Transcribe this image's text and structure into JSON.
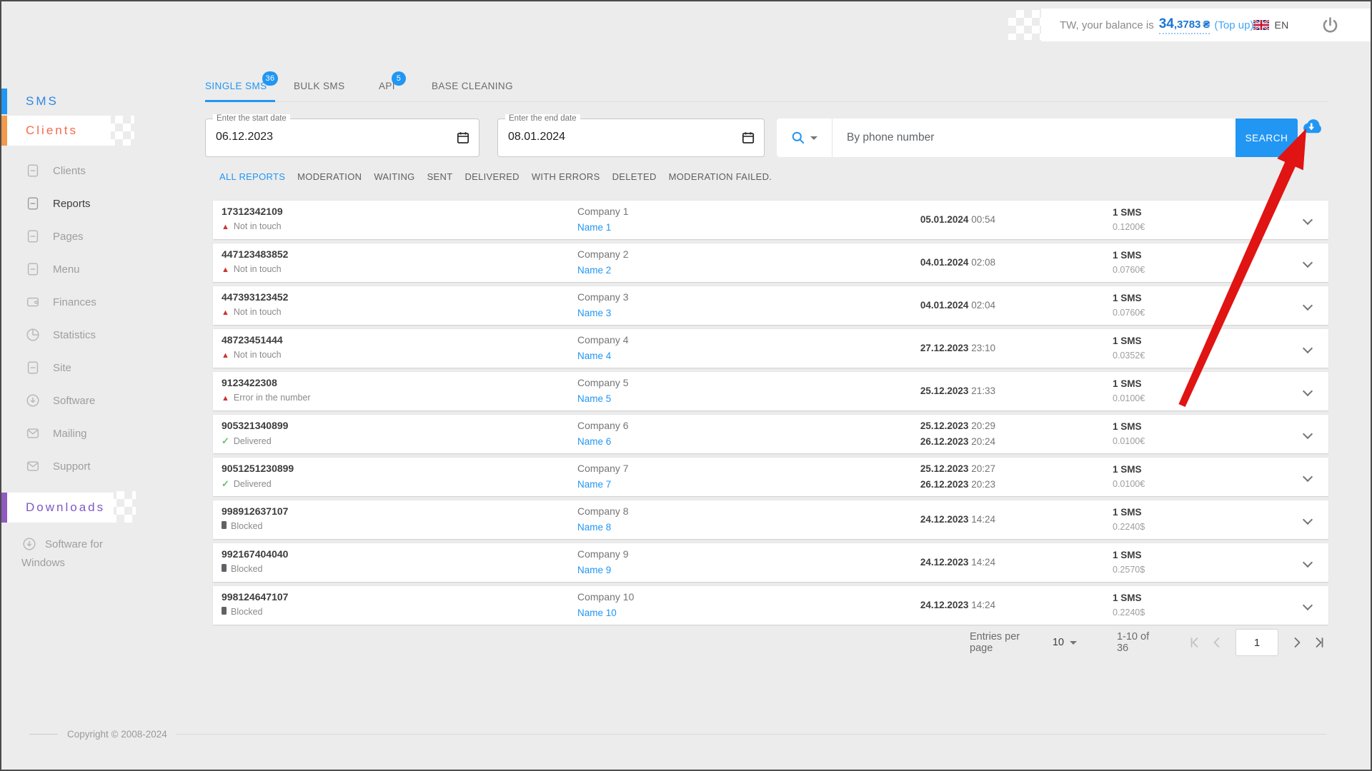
{
  "topbar": {
    "balance_prefix": "TW, your balance is",
    "balance_main": "34",
    "balance_frac": ",3783",
    "currency": "₴",
    "top_up": "(Top up)",
    "language": "EN"
  },
  "sidebar": {
    "group_sms": "SMS",
    "group_clients": "Clients",
    "nav": [
      {
        "label": "Clients",
        "icon": "document"
      },
      {
        "label": "Reports",
        "icon": "document"
      },
      {
        "label": "Pages",
        "icon": "document"
      },
      {
        "label": "Menu",
        "icon": "document"
      },
      {
        "label": "Finances",
        "icon": "wallet"
      },
      {
        "label": "Statistics",
        "icon": "pie-chart"
      },
      {
        "label": "Site",
        "icon": "document"
      },
      {
        "label": "Software",
        "icon": "download-circle"
      },
      {
        "label": "Mailing",
        "icon": "envelope"
      },
      {
        "label": "Support",
        "icon": "envelope"
      }
    ],
    "group_downloads": "Downloads",
    "software_windows": "Software for Windows",
    "copyright": "Copyright © 2008-2024"
  },
  "tabs": [
    {
      "label": "SINGLE SMS",
      "badge": "36"
    },
    {
      "label": "BULK SMS",
      "badge": ""
    },
    {
      "label": "API",
      "badge": "5"
    },
    {
      "label": "BASE CLEANING",
      "badge": ""
    }
  ],
  "filters": {
    "start_label": "Enter the start date",
    "start_value": "06.12.2023",
    "end_label": "Enter the end date",
    "end_value": "08.01.2024",
    "search_placeholder": "By phone number",
    "search_button": "SEARCH"
  },
  "report_tabs": [
    "ALL REPORTS",
    "MODERATION",
    "WAITING",
    "SENT",
    "DELIVERED",
    "WITH ERRORS",
    "DELETED",
    "MODERATION FAILED."
  ],
  "rows": [
    {
      "phone": "17312342109",
      "status": "Not in touch",
      "status_icon": "warning",
      "company": "Company 1",
      "name": "Name 1",
      "date1": "05.01.2024",
      "time1": "00:54",
      "date2": "",
      "time2": "",
      "sms": "1 SMS",
      "price": "0.1200€"
    },
    {
      "phone": "447123483852",
      "status": "Not in touch",
      "status_icon": "warning",
      "company": "Company 2",
      "name": "Name 2",
      "date1": "04.01.2024",
      "time1": "02:08",
      "date2": "",
      "time2": "",
      "sms": "1 SMS",
      "price": "0.0760€"
    },
    {
      "phone": "447393123452",
      "status": "Not in touch",
      "status_icon": "warning",
      "company": "Company 3",
      "name": "Name 3",
      "date1": "04.01.2024",
      "time1": "02:04",
      "date2": "",
      "time2": "",
      "sms": "1 SMS",
      "price": "0.0760€"
    },
    {
      "phone": "48723451444",
      "status": "Not in touch",
      "status_icon": "warning",
      "company": "Company 4",
      "name": "Name 4",
      "date1": "27.12.2023",
      "time1": "23:10",
      "date2": "",
      "time2": "",
      "sms": "1 SMS",
      "price": "0.0352€"
    },
    {
      "phone": "9123422308",
      "status": "Error in the number",
      "status_icon": "warning",
      "company": "Company 5",
      "name": "Name 5",
      "date1": "25.12.2023",
      "time1": "21:33",
      "date2": "",
      "time2": "",
      "sms": "1 SMS",
      "price": "0.0100€"
    },
    {
      "phone": "905321340899",
      "status": "Delivered",
      "status_icon": "check",
      "company": "Company 6",
      "name": "Name 6",
      "date1": "25.12.2023",
      "time1": "20:29",
      "date2": "26.12.2023",
      "time2": "20:24",
      "sms": "1 SMS",
      "price": "0.0100€"
    },
    {
      "phone": "9051251230899",
      "status": "Delivered",
      "status_icon": "check",
      "company": "Company 7",
      "name": "Name 7",
      "date1": "25.12.2023",
      "time1": "20:27",
      "date2": "26.12.2023",
      "time2": "20:23",
      "sms": "1 SMS",
      "price": "0.0100€"
    },
    {
      "phone": "998912637107",
      "status": "Blocked",
      "status_icon": "blocked",
      "company": "Company 8",
      "name": "Name 8",
      "date1": "24.12.2023",
      "time1": "14:24",
      "date2": "",
      "time2": "",
      "sms": "1 SMS",
      "price": "0.2240$"
    },
    {
      "phone": "992167404040",
      "status": "Blocked",
      "status_icon": "blocked",
      "company": "Company 9",
      "name": "Name 9",
      "date1": "24.12.2023",
      "time1": "14:24",
      "date2": "",
      "time2": "",
      "sms": "1 SMS",
      "price": "0.2570$"
    },
    {
      "phone": "998124647107",
      "status": "Blocked",
      "status_icon": "blocked",
      "company": "Company 10",
      "name": "Name 10",
      "date1": "24.12.2023",
      "time1": "14:24",
      "date2": "",
      "time2": "",
      "sms": "1 SMS",
      "price": "0.2240$"
    }
  ],
  "pagination": {
    "entries_label": "Entries per page",
    "entries_value": "10",
    "range": "1-10 of 36",
    "page": "1"
  },
  "colors": {
    "accent_blue": "#2196F3",
    "accent_orange": "#f46a4d",
    "accent_purple": "#7e57c2",
    "warning_red": "#c9342c",
    "delivered_green": "#6abf69",
    "arrow_red": "#df1413"
  }
}
